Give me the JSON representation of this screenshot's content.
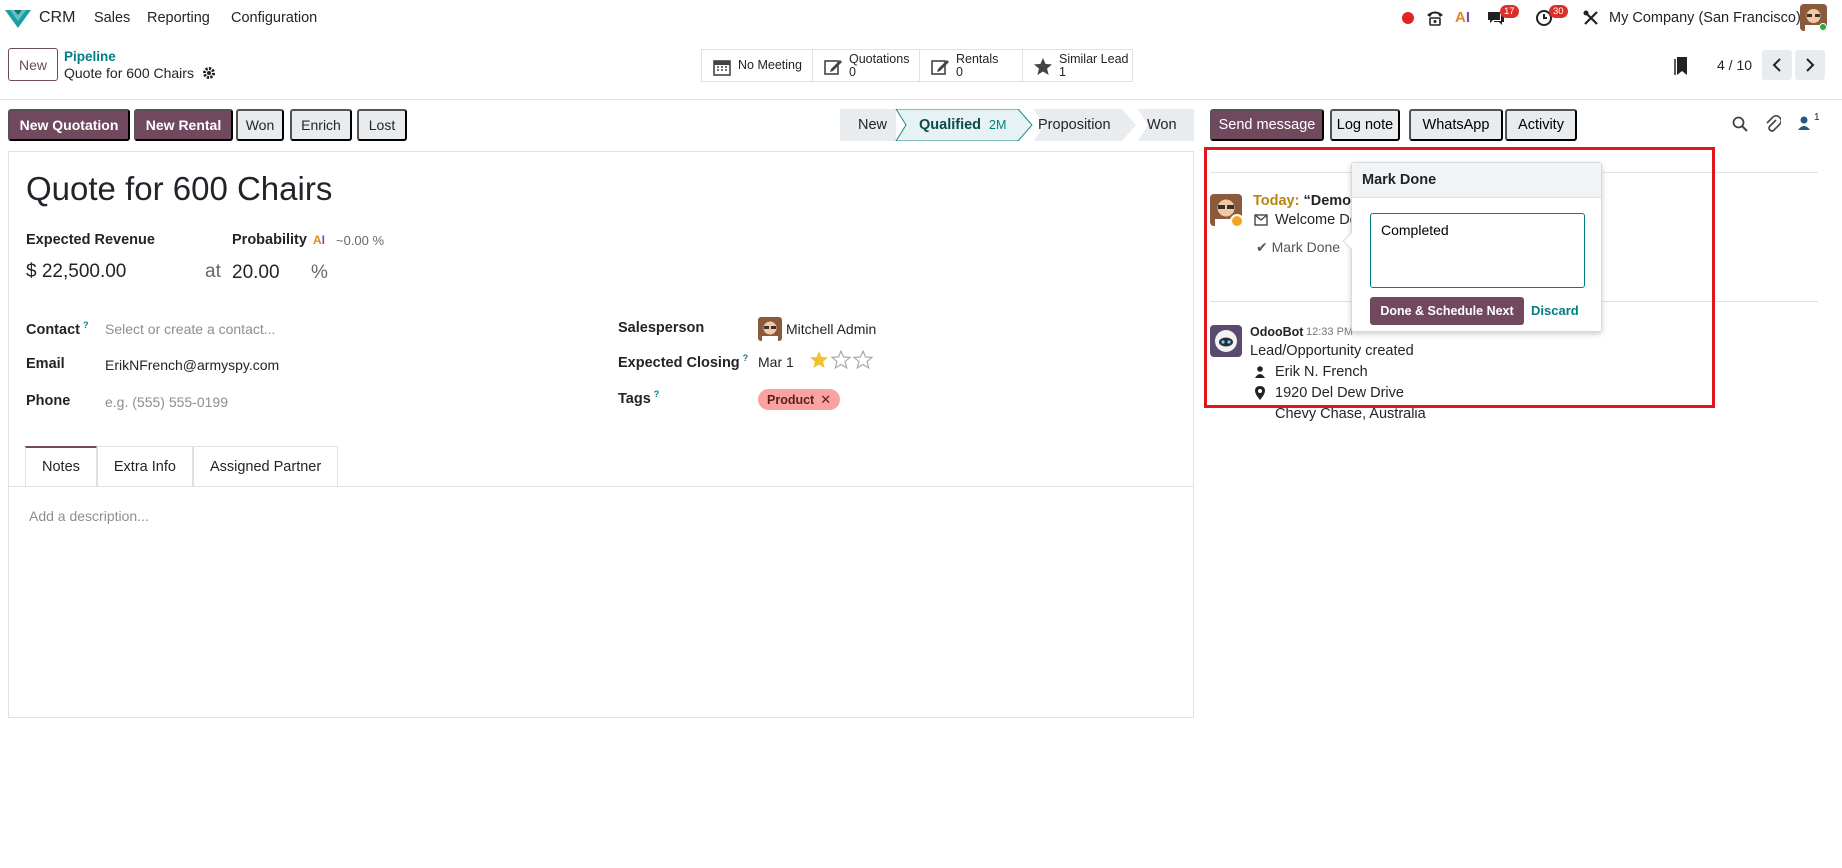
{
  "navbar": {
    "app_name": "CRM",
    "menus": [
      "Sales",
      "Reporting",
      "Configuration"
    ],
    "chat_count": "17",
    "activity_count": "30",
    "company": "My Company (San Francisco)"
  },
  "breadcrumb": {
    "new_label": "New",
    "parent": "Pipeline",
    "current": "Quote for 600 Chairs"
  },
  "smart_buttons": [
    {
      "label": "No Meeting",
      "count": ""
    },
    {
      "label": "Quotations",
      "count": "0"
    },
    {
      "label": "Rentals",
      "count": "0"
    },
    {
      "label": "Similar Lead",
      "count": "1"
    }
  ],
  "pager": {
    "value": "4 / 10"
  },
  "actions": [
    "New Quotation",
    "New Rental",
    "Won",
    "Enrich",
    "Lost"
  ],
  "stages": {
    "items": [
      "New",
      "Qualified",
      "Proposition",
      "Won"
    ],
    "current_duration": "2M"
  },
  "form": {
    "title": "Quote for 600 Chairs",
    "expected_revenue_label": "Expected Revenue",
    "expected_revenue": "$ 22,500.00",
    "at_label": "at",
    "probability_label": "Probability",
    "ai_probability": "~0.00 %",
    "probability": "20.00",
    "percent": "%",
    "contact_label": "Contact",
    "contact_placeholder": "Select or create a contact...",
    "email_label": "Email",
    "email": "ErikNFrench@armyspy.com",
    "phone_label": "Phone",
    "phone_placeholder": "e.g. (555) 555-0199",
    "salesperson_label": "Salesperson",
    "salesperson": "Mitchell Admin",
    "closing_label": "Expected Closing",
    "closing": "Mar 1",
    "priority_stars": 1,
    "tags_label": "Tags",
    "tag": "Product",
    "help_mark": "?",
    "tabs": [
      "Notes",
      "Extra Info",
      "Assigned Partner"
    ],
    "description_placeholder": "Add a description..."
  },
  "chatter": {
    "buttons": [
      "Send message",
      "Log note",
      "WhatsApp",
      "Activity"
    ],
    "followers_count": "1",
    "activity": {
      "prefix": "Today:",
      "summary": "“Demo",
      "detail": "Welcome De",
      "mark_done": "Mark Done"
    },
    "message": {
      "author": "OdooBot",
      "time": "12:33 PM",
      "body": "Lead/Opportunity created",
      "contact": "Erik N. French",
      "street": "1920 Del Dew Drive",
      "city": "Chevy Chase, Australia"
    }
  },
  "popover": {
    "title": "Mark Done",
    "feedback": "Completed",
    "done_button": "Done & Schedule Next",
    "discard": "Discard"
  },
  "colors": {
    "brand": "#71495f",
    "link": "#017e84",
    "highlight": "#e0161c"
  }
}
